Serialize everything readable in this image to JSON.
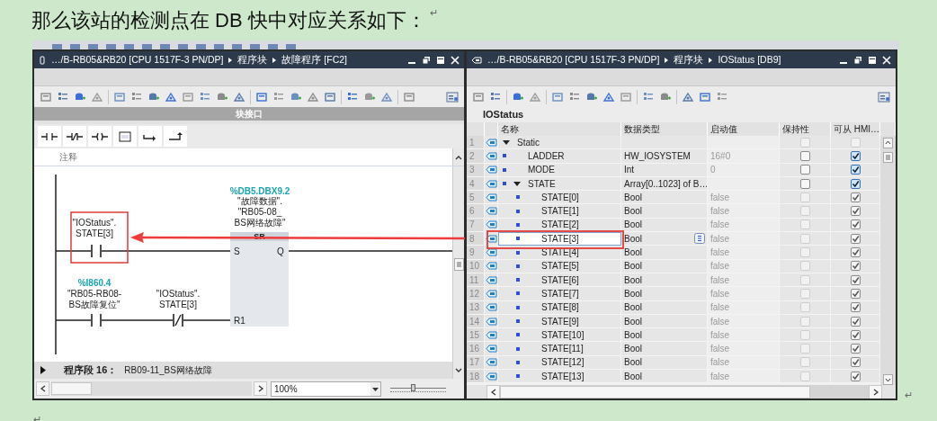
{
  "heading": {
    "text": "那么该站的检测点在 DB 快中对应关系如下：",
    "mark": "↵"
  },
  "program_editor": {
    "breadcrumb": [
      "…/B-RB05&RB20 [CPU 1517F-3 PN/DP]",
      "程序块",
      "故障程序 [FC2]"
    ],
    "interface_label": "块接口",
    "comment": "注释",
    "network": {
      "set_input": {
        "kind": "no",
        "operand": "\"IOStatus\".\nSTATE[3]"
      },
      "reset_inputs": [
        {
          "kind": "no",
          "address": "%I860.4",
          "operand": "\"RB05-RB08-\nBS故障复位\""
        },
        {
          "kind": "nc",
          "operand": "\"IOStatus\".\nSTATE[3]"
        }
      ],
      "block": {
        "address": "%DB5.DBX9.2",
        "operand": "\"故障数据\".\n\"RB05-08_\nBS网络故障\"",
        "type": "SR",
        "pins": [
          "S",
          "Q",
          "R1"
        ]
      }
    },
    "next_network": {
      "title": "程序段 16：",
      "comment": "RB09-11_BS网络故障",
      "expanded": false
    },
    "zoom": {
      "value": "100%",
      "level": 0.4
    }
  },
  "db_editor": {
    "breadcrumb": [
      "…/B-RB05&RB20 [CPU 1517F-3 PN/DP]",
      "程序块",
      "IOStatus [DB9]"
    ],
    "block_name": "IOStatus",
    "columns": [
      "名称",
      "数据类型",
      "启动值",
      "保持性",
      "可从 HMI…"
    ],
    "rows": [
      {
        "num": "1",
        "name": "Static",
        "expanded": true,
        "selected": false,
        "retain": {
          "checked": false,
          "disabled": true
        },
        "hmi": {
          "checked": false,
          "disabled": true
        },
        "children": [
          {
            "num": "2",
            "name": "LADDER",
            "type": "HW_IOSYSTEM",
            "start": "16#0",
            "selected": false,
            "retain": {
              "checked": false,
              "disabled": false
            },
            "hmi": {
              "checked": true,
              "disabled": false
            }
          },
          {
            "num": "3",
            "name": "MODE",
            "type": "Int",
            "start": "0",
            "selected": false,
            "retain": {
              "checked": false,
              "disabled": false
            },
            "hmi": {
              "checked": true,
              "disabled": false
            }
          },
          {
            "num": "4",
            "name": "STATE",
            "type": "Array[0..1023] of B…",
            "expanded": true,
            "selected": false,
            "retain": {
              "checked": false,
              "disabled": false
            },
            "hmi": {
              "checked": true,
              "disabled": false
            },
            "children": [
              {
                "num": "5",
                "name": "STATE[0]",
                "type": "Bool",
                "start": "false",
                "selected": false,
                "retain": {
                  "checked": false,
                  "disabled": true
                },
                "hmi": {
                  "checked": true,
                  "disabled": true
                }
              },
              {
                "num": "6",
                "name": "STATE[1]",
                "type": "Bool",
                "start": "false",
                "selected": false,
                "retain": {
                  "checked": false,
                  "disabled": true
                },
                "hmi": {
                  "checked": true,
                  "disabled": true
                }
              },
              {
                "num": "7",
                "name": "STATE[2]",
                "type": "Bool",
                "start": "false",
                "selected": false,
                "retain": {
                  "checked": false,
                  "disabled": true
                },
                "hmi": {
                  "checked": true,
                  "disabled": true
                }
              },
              {
                "num": "8",
                "name": "STATE[3]",
                "type": "Bool",
                "start": "false",
                "selected": true,
                "retain": {
                  "checked": false,
                  "disabled": true
                },
                "hmi": {
                  "checked": true,
                  "disabled": true
                }
              },
              {
                "num": "9",
                "name": "STATE[4]",
                "type": "Bool",
                "start": "false",
                "selected": false,
                "retain": {
                  "checked": false,
                  "disabled": true
                },
                "hmi": {
                  "checked": true,
                  "disabled": true
                }
              },
              {
                "num": "10",
                "name": "STATE[5]",
                "type": "Bool",
                "start": "false",
                "selected": false,
                "retain": {
                  "checked": false,
                  "disabled": true
                },
                "hmi": {
                  "checked": true,
                  "disabled": true
                }
              },
              {
                "num": "11",
                "name": "STATE[6]",
                "type": "Bool",
                "start": "false",
                "selected": false,
                "retain": {
                  "checked": false,
                  "disabled": true
                },
                "hmi": {
                  "checked": true,
                  "disabled": true
                }
              },
              {
                "num": "12",
                "name": "STATE[7]",
                "type": "Bool",
                "start": "false",
                "selected": false,
                "retain": {
                  "checked": false,
                  "disabled": true
                },
                "hmi": {
                  "checked": true,
                  "disabled": true
                }
              },
              {
                "num": "13",
                "name": "STATE[8]",
                "type": "Bool",
                "start": "false",
                "selected": false,
                "retain": {
                  "checked": false,
                  "disabled": true
                },
                "hmi": {
                  "checked": true,
                  "disabled": true
                }
              },
              {
                "num": "14",
                "name": "STATE[9]",
                "type": "Bool",
                "start": "false",
                "selected": false,
                "retain": {
                  "checked": false,
                  "disabled": true
                },
                "hmi": {
                  "checked": true,
                  "disabled": true
                }
              },
              {
                "num": "15",
                "name": "STATE[10]",
                "type": "Bool",
                "start": "false",
                "selected": false,
                "retain": {
                  "checked": false,
                  "disabled": true
                },
                "hmi": {
                  "checked": true,
                  "disabled": true
                }
              },
              {
                "num": "16",
                "name": "STATE[11]",
                "type": "Bool",
                "start": "false",
                "selected": false,
                "retain": {
                  "checked": false,
                  "disabled": true
                },
                "hmi": {
                  "checked": true,
                  "disabled": true
                }
              },
              {
                "num": "17",
                "name": "STATE[12]",
                "type": "Bool",
                "start": "false",
                "selected": false,
                "retain": {
                  "checked": false,
                  "disabled": true
                },
                "hmi": {
                  "checked": true,
                  "disabled": true
                }
              },
              {
                "num": "18",
                "name": "STATE[13]",
                "type": "Bool",
                "start": "false",
                "selected": false,
                "retain": {
                  "checked": false,
                  "disabled": true
                },
                "hmi": {
                  "checked": true,
                  "disabled": true
                }
              }
            ]
          }
        ]
      }
    ]
  },
  "paragraph_marks": [
    "↵",
    "↵"
  ]
}
